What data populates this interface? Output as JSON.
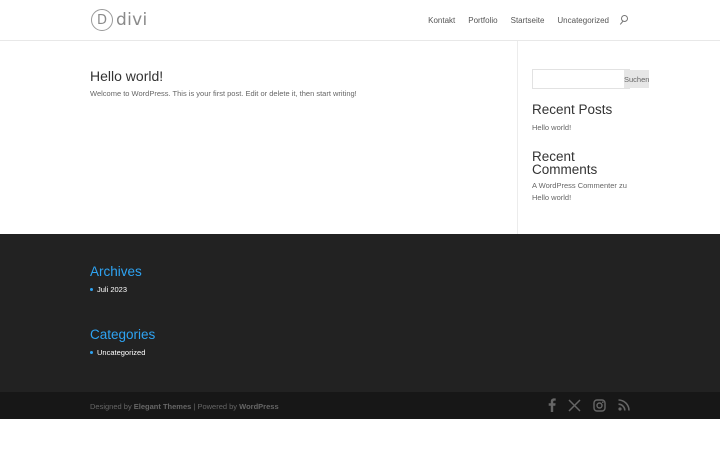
{
  "header": {
    "logo_mark": "D",
    "logo_text": "divi",
    "nav": [
      "Kontakt",
      "Portfolio",
      "Startseite",
      "Uncategorized"
    ]
  },
  "post": {
    "title": "Hello world!",
    "excerpt": "Welcome to WordPress. This is your first post. Edit or delete it, then start writing!"
  },
  "sidebar": {
    "search_placeholder": "",
    "search_button": "Suchen",
    "recent_posts_heading": "Recent Posts",
    "recent_posts": [
      "Hello world!"
    ],
    "recent_comments_heading_line1": "Recent",
    "recent_comments_heading_line2": "Comments",
    "comment_author": "A WordPress Commenter",
    "comment_on": "zu",
    "comment_post": "Hello world!"
  },
  "footer": {
    "archives_heading": "Archives",
    "archives": [
      "Juli 2023"
    ],
    "categories_heading": "Categories",
    "categories": [
      "Uncategorized"
    ]
  },
  "bottom": {
    "designed_by": "Designed by",
    "elegant_themes": "Elegant Themes",
    "separator": "| Powered by",
    "wordpress": "WordPress",
    "social_icons": [
      "facebook-icon",
      "x-icon",
      "instagram-icon",
      "rss-icon"
    ]
  },
  "colors": {
    "accent": "#2ea3f2",
    "footer_bg": "#222222",
    "bottom_bar_bg": "#171717"
  }
}
